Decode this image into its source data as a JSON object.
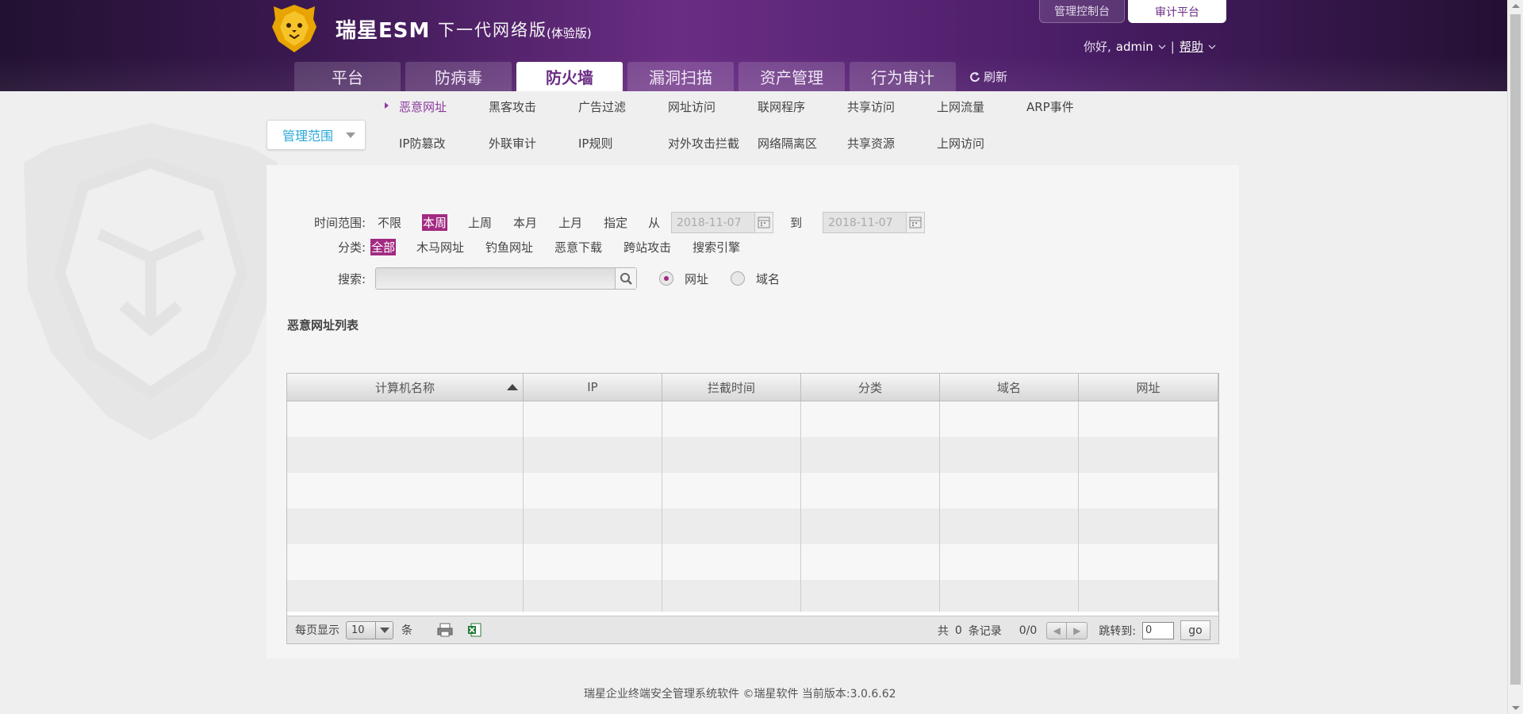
{
  "header": {
    "brand": "瑞星ESM",
    "slogan": "下一代网络版",
    "edition": "(体验版)",
    "top_tabs": [
      {
        "label": "管理控制台",
        "active": false
      },
      {
        "label": "审计平台",
        "active": true
      }
    ],
    "greeting": "你好,",
    "user": "admin",
    "help": "帮助"
  },
  "main_nav": {
    "items": [
      "平台",
      "防病毒",
      "防火墙",
      "漏洞扫描",
      "资产管理",
      "行为审计"
    ],
    "active": "防火墙",
    "refresh": "刷新"
  },
  "scope": {
    "label": "管理范围"
  },
  "subnav": {
    "row1": [
      "恶意网址",
      "黑客攻击",
      "广告过滤",
      "网址访问",
      "联网程序",
      "共享访问",
      "上网流量",
      "ARP事件"
    ],
    "row2": [
      "IP防篡改",
      "外联审计",
      "IP规则",
      "对外攻击拦截",
      "网络隔离区",
      "共享资源",
      "上网访问"
    ],
    "active": "恶意网址"
  },
  "filters": {
    "time_label": "时间范围:",
    "time_options": [
      "不限",
      "本周",
      "上周",
      "本月",
      "上月",
      "指定"
    ],
    "time_selected": "本周",
    "from_label": "从",
    "from_date": "2018-11-07",
    "to_label": "到",
    "to_date": "2018-11-07",
    "category_label": "分类:",
    "category_options": [
      "全部",
      "木马网址",
      "钓鱼网址",
      "恶意下载",
      "跨站攻击",
      "搜索引擎"
    ],
    "category_selected": "全部",
    "search_label": "搜索:",
    "search_value": "",
    "search_modes": [
      "网址",
      "域名"
    ],
    "search_mode_selected": "网址"
  },
  "list": {
    "title": "恶意网址列表",
    "columns": [
      "计算机名称",
      "IP",
      "拦截时间",
      "分类",
      "域名",
      "网址"
    ],
    "sorted_column": "计算机名称",
    "rows": []
  },
  "pager": {
    "per_page_label": "每页显示",
    "per_page": "10",
    "unit": "条",
    "total_prefix": "共",
    "total": "0",
    "total_suffix": "条记录",
    "page_info": "0/0",
    "jump_label": "跳转到:",
    "jump_value": "0",
    "go": "go"
  },
  "footer": "瑞星企业终端安全管理系统软件 ©瑞星软件   当前版本:3.0.6.62",
  "colors": {
    "accent": "#a22a82",
    "nav_purple": "#6a2d84",
    "scope_blue": "#2aa7d8"
  }
}
